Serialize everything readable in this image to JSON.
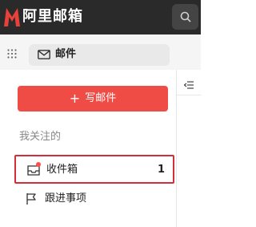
{
  "header": {
    "app_title": "阿里邮箱",
    "logo_icon": "mail-logo-icon",
    "brand_color": "#e8413a",
    "search_icon": "search-icon"
  },
  "subbar": {
    "apps_icon": "grid-icon",
    "active_tab_label": "邮件",
    "active_tab_icon": "envelope-icon"
  },
  "sidebar": {
    "compose_label": "写邮件",
    "compose_icon": "plus-icon",
    "compose_color": "#ee4c45",
    "section_title": "我关注的",
    "folders": [
      {
        "label": "收件箱",
        "icon": "inbox-icon",
        "count": "1",
        "unread_dot": true,
        "selected": true
      },
      {
        "label": "跟进事项",
        "icon": "flag-icon"
      }
    ]
  },
  "right_panel": {
    "collapse_icon": "collapse-icon"
  }
}
